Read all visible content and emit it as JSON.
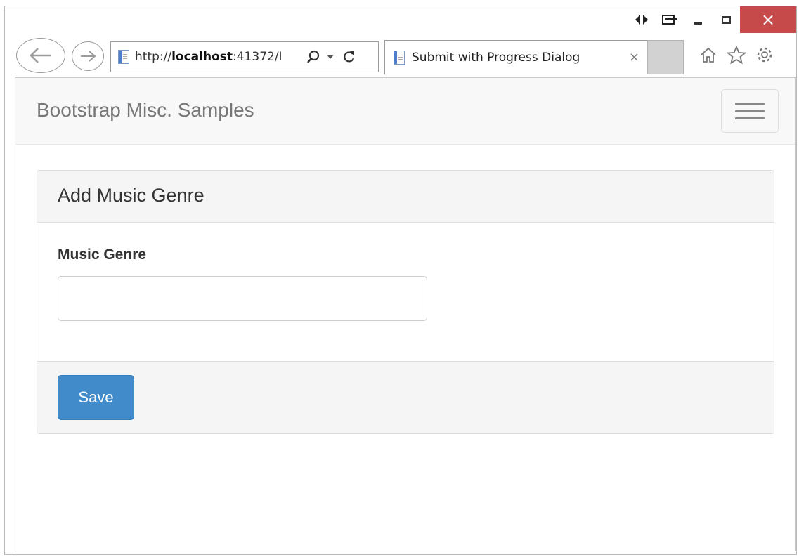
{
  "browser": {
    "address_url_prefix": "http://",
    "address_url_host": "localhost",
    "address_url_rest": ":41372/I",
    "tab_title": "Submit with Progress Dialog",
    "tab_close": "×",
    "close_glyph": "×",
    "icons": [
      "arrow-left-icon",
      "arrow-right-icon",
      "page-icon",
      "search-icon",
      "refresh-icon",
      "home-icon",
      "star-icon",
      "gear-icon"
    ]
  },
  "navbar": {
    "brand": "Bootstrap Misc. Samples",
    "toggle_icon": "hamburger-menu-icon"
  },
  "panel": {
    "heading": "Add Music Genre",
    "field_label": "Music Genre",
    "field_value": "",
    "field_placeholder": "",
    "save_label": "Save"
  },
  "colors": {
    "primary": "#428bca",
    "close_red": "#c74a4a",
    "navbar_bg": "#f8f8f8",
    "panel_heading_bg": "#f5f5f5"
  }
}
